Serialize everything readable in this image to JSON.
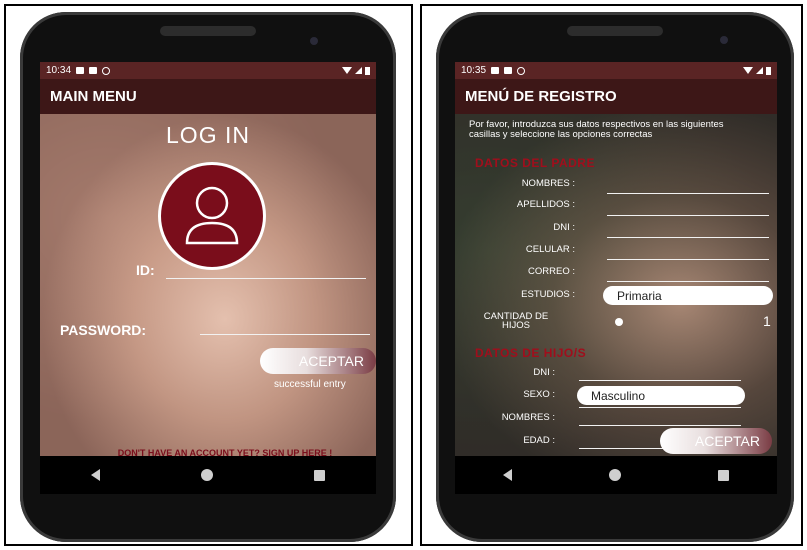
{
  "left": {
    "status": {
      "time": "10:34"
    },
    "appbar_title": "MAIN MENU",
    "title": "LOG IN",
    "id_label": "ID:",
    "password_label": "PASSWORD:",
    "button_label": "ACEPTAR",
    "status_message": "successful entry",
    "signup_text": "DON'T HAVE AN ACCOUNT YET? SIGN UP HERE !"
  },
  "right": {
    "status": {
      "time": "10:35"
    },
    "appbar_title": "MENÚ DE REGISTRO",
    "intro": "Por favor, introduzca sus datos respectivos en las siguientes casillas y seleccione las opciones correctas",
    "section_padre": "DATOS DEL PADRE",
    "padre_fields": [
      "NOMBRES :",
      "APELLIDOS :",
      "DNI :",
      "CELULAR :",
      "CORREO :"
    ],
    "estudios_label": "ESTUDIOS :",
    "estudios_value": "Primaria",
    "hijos_label": "CANTIDAD DE HIJOS",
    "hijos_value": "1",
    "section_hijo": "DATOS DE HIJO/S",
    "hijo_dni_label": "DNI :",
    "sexo_label": "SEXO :",
    "sexo_value": "Masculino",
    "hijo_nombres_label": "NOMBRES :",
    "edad_label": "EDAD :",
    "button_label": "ACEPTAR"
  },
  "colors": {
    "statusbar": "#5a2424",
    "appbar": "#3d1717",
    "accent": "#7a0d1b",
    "section": "#a00e1c"
  }
}
